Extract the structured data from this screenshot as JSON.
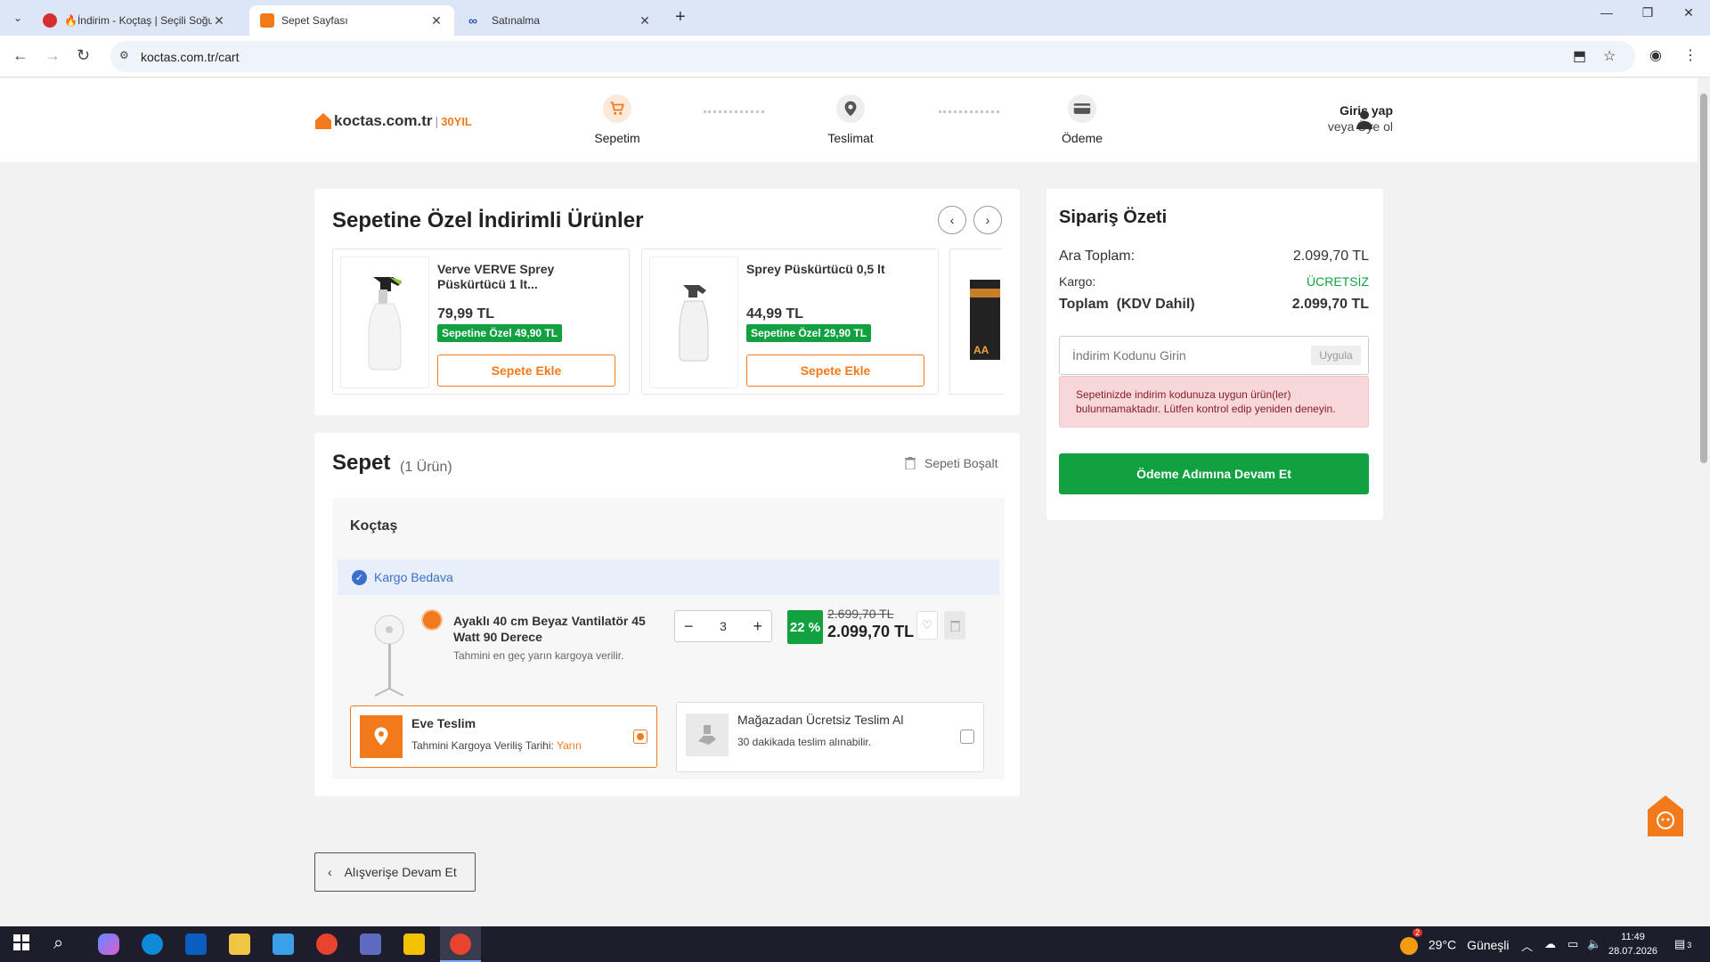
{
  "browser": {
    "tabs": [
      {
        "title": "🔥İndirim - Koçtaş | Seçili Soğut",
        "active": false,
        "favicon": "red-circle"
      },
      {
        "title": "Sepet Sayfası",
        "active": true,
        "favicon": "koctas-house"
      },
      {
        "title": "Satınalma",
        "active": false,
        "favicon": "infinity"
      }
    ],
    "url": "koctas.com.tr/cart"
  },
  "header": {
    "logo_brand": "koctas.com.tr",
    "logo_sep": "|",
    "logo_anniv": "30YIL",
    "steps": [
      {
        "label": "Sepetim",
        "icon": "cart-icon",
        "active": true
      },
      {
        "label": "Teslimat",
        "icon": "location-pin-icon",
        "active": false
      },
      {
        "label": "Ödeme",
        "icon": "card-icon",
        "active": false
      }
    ],
    "login": "Giriş yap",
    "register": "veya Üye ol"
  },
  "promo": {
    "title": "Sepetine Özel İndirimli Ürünler",
    "products": [
      {
        "name": "Verve VERVE Sprey Püskürtücü 1 lt...",
        "price": "79,99 TL",
        "deal": "Sepetine Özel 49,90 TL",
        "button": "Sepete Ekle"
      },
      {
        "name": "Sprey Püskürtücü 0,5 lt",
        "price": "44,99 TL",
        "deal": "Sepetine Özel 29,90 TL",
        "button": "Sepete Ekle"
      }
    ],
    "partial_product_mark": "AA"
  },
  "cart": {
    "title": "Sepet",
    "count": "(1 Ürün)",
    "empty_label": "Sepeti Boşalt",
    "seller": "Koçtaş",
    "cargo": "Kargo Bedava",
    "item": {
      "name": "Ayaklı 40 cm Beyaz Vantilatör 45 Watt 90 Derece",
      "note": "Tahmini en geç yarın kargoya verilir.",
      "qty": "3",
      "discount": "22 %",
      "old_price": "2.699,70 TL",
      "new_price": "2.099,70 TL"
    },
    "delivery_home": {
      "title": "Eve Teslim",
      "sub": "Tahmini Kargoya Veriliş Tarihi:",
      "date": "Yarın"
    },
    "delivery_store": {
      "title": "Mağazadan Ücretsiz Teslim Al",
      "sub": "30 dakikada teslim alınabilir."
    }
  },
  "back_button": "Alışverişe Devam Et",
  "summary": {
    "title": "Sipariş Özeti",
    "subtotal_label": "Ara Toplam:",
    "subtotal": "2.099,70 TL",
    "cargo_label": "Kargo:",
    "cargo": "ÜCRETSİZ",
    "total_label": "Toplam  (KDV Dahil)",
    "total": "2.099,70 TL",
    "coupon_placeholder": "İndirim Kodunu Girin",
    "apply": "Uygula",
    "alert": "Sepetinizde indirim kodunuza uygun ürün(ler) bulunmamaktadır. Lütfen kontrol edip yeniden deneyin.",
    "pay_button": "Ödeme Adımına Devam Et"
  },
  "taskbar": {
    "temp": "29°C",
    "weather": "Güneşli",
    "weather_badge": "2",
    "time": "11:49",
    "date": "28.07.2026",
    "notif": "3"
  },
  "colors": {
    "accent": "#f27a1a",
    "green": "#12a140",
    "link_blue": "#3b6fcc"
  }
}
